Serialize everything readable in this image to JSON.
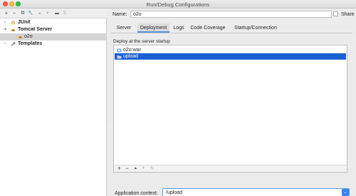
{
  "window": {
    "title": "Run/Debug Configurations"
  },
  "left_toolbar": {
    "add": "+",
    "remove": "−",
    "copy": "⧉",
    "wrench": "🔧",
    "up": "▲",
    "down": "▼",
    "folder": "▬",
    "sort": "⇅"
  },
  "tree": {
    "items": [
      {
        "label": "JUnit",
        "arrow": "›"
      },
      {
        "label": "Tomcat Server",
        "arrow": "▾"
      },
      {
        "label": "o2o"
      },
      {
        "label": "Templates",
        "arrow": "›"
      }
    ]
  },
  "config": {
    "name_label": "Name:",
    "name_value": "o2o",
    "share_label": "Share"
  },
  "tabs": [
    {
      "label": "Server"
    },
    {
      "label": "Deployment"
    },
    {
      "label": "Logs"
    },
    {
      "label": "Code Coverage"
    },
    {
      "label": "Startup/Connection"
    }
  ],
  "deployment": {
    "section_label": "Deploy at the server startup",
    "artifacts": [
      {
        "label": "o2o:war",
        "icon": "artifact-icon"
      },
      {
        "label": "upload",
        "icon": "folder-icon"
      }
    ],
    "list_toolbar": {
      "add": "+",
      "remove": "−",
      "up": "▲",
      "down": "▼",
      "edit": "✎"
    },
    "context_label": "Application context:",
    "context_value": "/upload",
    "context_arrow": "⌄"
  },
  "colors": {
    "selection": "#1a5fd4",
    "accent": "#3b82f0"
  }
}
